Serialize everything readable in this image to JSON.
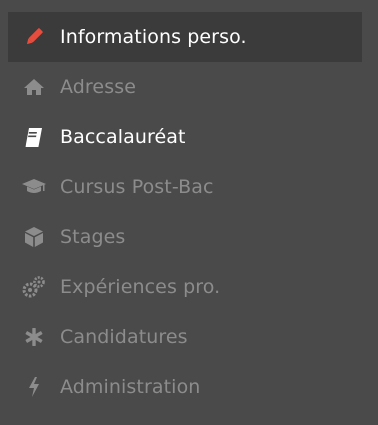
{
  "sidebar": {
    "items": [
      {
        "label": "Informations perso.",
        "icon": "pencil-icon",
        "state": "active",
        "icon_color": "#e74c3c"
      },
      {
        "label": "Adresse",
        "icon": "home-icon",
        "state": "disabled",
        "icon_color": "#8c8c8c"
      },
      {
        "label": "Baccalauréat",
        "icon": "book-icon",
        "state": "enabled",
        "icon_color": "#ffffff"
      },
      {
        "label": "Cursus Post-Bac",
        "icon": "graduation-cap-icon",
        "state": "disabled",
        "icon_color": "#8c8c8c"
      },
      {
        "label": "Stages",
        "icon": "cube-icon",
        "state": "disabled",
        "icon_color": "#8c8c8c"
      },
      {
        "label": "Expériences pro.",
        "icon": "cogs-icon",
        "state": "disabled",
        "icon_color": "#8c8c8c"
      },
      {
        "label": "Candidatures",
        "icon": "asterisk-icon",
        "state": "disabled",
        "icon_color": "#8c8c8c"
      },
      {
        "label": "Administration",
        "icon": "bolt-icon",
        "state": "disabled",
        "icon_color": "#8c8c8c"
      }
    ]
  },
  "colors": {
    "background": "#4a4a4a",
    "active_background": "#3b3b3b",
    "accent": "#e74c3c",
    "text_enabled": "#ffffff",
    "text_disabled": "#8c8c8c"
  }
}
